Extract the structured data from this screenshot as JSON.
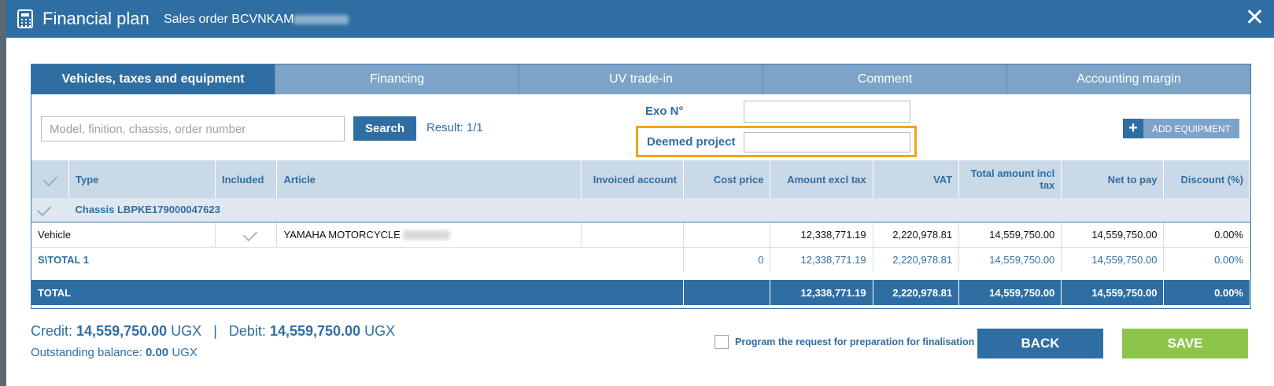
{
  "window": {
    "title": "Financial plan",
    "subtitle": "Sales order BCVNKAM"
  },
  "tabs": [
    {
      "label": "Vehicles, taxes and equipment"
    },
    {
      "label": "Financing"
    },
    {
      "label": "UV trade-in"
    },
    {
      "label": "Comment"
    },
    {
      "label": "Accounting margin"
    }
  ],
  "search": {
    "placeholder": "Model, finition, chassis, order number",
    "button": "Search",
    "result": "Result: 1/1"
  },
  "exo": {
    "label": "Exo N°",
    "value": ""
  },
  "deemed": {
    "label": "Deemed project",
    "value": ""
  },
  "add_equipment": {
    "label": "ADD EQUIPMENT"
  },
  "table": {
    "headers": [
      "Type",
      "Included",
      "Article",
      "Invoiced account",
      "Cost price",
      "Amount excl tax",
      "VAT",
      "Total amount incl tax",
      "Net to pay",
      "Discount (%)"
    ],
    "chassis": "Chassis LBPKE179000047623",
    "vehicle": {
      "type": "Vehicle",
      "article": "YAMAHA MOTORCYCLE",
      "invoiced": "",
      "cost": "",
      "amount": "12,338,771.19",
      "vat": "2,220,978.81",
      "total": "14,559,750.00",
      "net": "14,559,750.00",
      "discount": "0.00%"
    },
    "subtotal": {
      "label": "S\\TOTAL 1",
      "cost": "0",
      "amount": "12,338,771.19",
      "vat": "2,220,978.81",
      "total": "14,559,750.00",
      "net": "14,559,750.00",
      "discount": "0.00%"
    },
    "total": {
      "label": "TOTAL",
      "amount": "12,338,771.19",
      "vat": "2,220,978.81",
      "total": "14,559,750.00",
      "net": "14,559,750.00",
      "discount": "0.00%"
    }
  },
  "footer": {
    "credit_label": "Credit:",
    "credit_value": "14,559,750.00",
    "currency": "UGX",
    "separator": "|",
    "debit_label": "Debit:",
    "debit_value": "14,559,750.00",
    "balance_label": "Outstanding balance:",
    "balance_value": "0.00",
    "program_label": "Program the request for preparation for finalisation",
    "back": "BACK",
    "save": "SAVE"
  },
  "colors": {
    "primary": "#2f6ea3",
    "tab_inactive": "#7da4c8",
    "highlight": "#f2a515",
    "save": "#8dc54a"
  }
}
